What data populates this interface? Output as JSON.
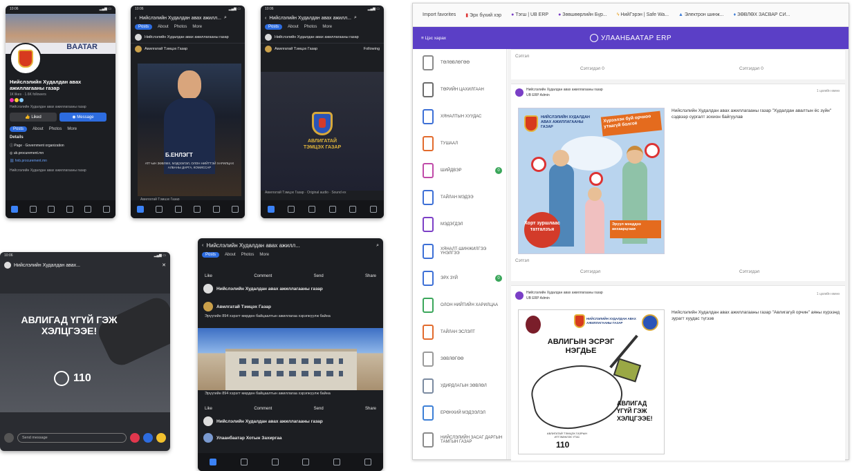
{
  "phone1": {
    "status_time": "10:06",
    "cover_text": "BAATAR",
    "page_name": "Нийслэлийн Худалдан авах ажиллагааны газар",
    "likes_line": "1К likes · 1.6K followers",
    "bio": "Нийслэлийн Худалдан авах ажиллагааны газар",
    "liked_label": "Liked",
    "message_label": "Message",
    "tabs": [
      "Posts",
      "About",
      "Photos",
      "More"
    ],
    "details_title": "Details",
    "detail_items": [
      "Page · Government organization",
      "ub.procurement.mn",
      "hnb.procurement.mn"
    ],
    "footer_text": "Нийслэлийн Худалдан авах ажиллагааны газар"
  },
  "phone2": {
    "status_time": "10:06",
    "header_title": "Нийслэлийн Худалдан авах ажилл...",
    "tabs": [
      "Posts",
      "About",
      "Photos",
      "More"
    ],
    "post_author": "Нийслэлийн Худалдан авах ажиллагааны газар",
    "shared_author": "Авилгатай Тэмцэх Газар",
    "person_name": "Б.ЕНЛЭГТ",
    "caption": "АТГ-ЫН ЗӨВЛӨХ, МЭДЭЭЛЭЛ, ОЛОН НИЙТТЭЙ ХАРИЛЦАХ АЛБАНЫ ДАРГА, КОМИССАР",
    "footer": "Авилгатай Тэмцэх Газар"
  },
  "phone3": {
    "status_time": "10:06",
    "header_title": "Нийслэлийн Худалдан авах ажилл...",
    "tabs": [
      "Posts",
      "About",
      "Photos",
      "More"
    ],
    "post_author": "Нийслэлийн Худалдан авах ажиллагааны газар",
    "shared_author": "Авилгатай Тэмцэх Газар",
    "following": "Following",
    "logo_text": "АВЛИГАТАЙ ТЭМЦЭХ ГАЗАР",
    "footer": "Авилгатай Тэмцэх Газар · Original audio · Sound ex"
  },
  "phone4": {
    "status_time": "10:06",
    "header_title": "Нийслэлийн Худалдан авах...",
    "headline": "АВЛИГАД ҮГҮЙ ГЭЖ ХЭЛЦГЭЭЕ!",
    "hotline": "110",
    "message_placeholder": "Send message"
  },
  "phone5": {
    "header_title": "Нийслэлийн Худалдан авах ажилл...",
    "tabs": [
      "Posts",
      "About",
      "Photos",
      "More"
    ],
    "like": "Like",
    "comment": "Comment",
    "send": "Send",
    "share": "Share",
    "post1_author": "Нийслэлийн Худалдан авах ажиллагааны газар",
    "post2_author": "Авилгатай Тэмцэх Газар",
    "post2_text": "Эрүүгийн 894 хэрэгт мөрдөн байцаалтын ажиллагаа хэрэгжүүлж байна",
    "image_caption": "Эрүүгийн 894 хэрэгт мөрдөн байцаалтын ажиллагаа хэрэгжүүлж байна",
    "post3_author": "Нийслэлийн Худалдан авах ажиллагааны газар",
    "post4_author": "Улаанбаатар Хотын Захиргаа"
  },
  "browser": {
    "bookmarks": [
      "Import favorites",
      "Эрх бүхий хэр",
      "Тэгш | UB ERP",
      "Зөвшөөрлийн Бүр...",
      "НийГэрэн | Safe Wa...",
      "Электрон шинж...",
      "ЗӨВЛӨХ ЗАСВАР СИ..."
    ],
    "menu_label": "Цэс харах",
    "app_title": "УЛААНБААТАР ERP",
    "sidebar_items": [
      {
        "label": "ТӨЛӨВЛӨГӨӨ",
        "color": "#8a8a8a",
        "badge": ""
      },
      {
        "label": "ТӨРИЙН ЦАХИЛГААН",
        "color": "#6b6b6b",
        "badge": ""
      },
      {
        "label": "ХЯНАЛТЫН ХУУДАС",
        "color": "#3c6fd6",
        "badge": ""
      },
      {
        "label": "ТУШААЛ",
        "color": "#e26a2c",
        "badge": ""
      },
      {
        "label": "ШИЙДВЭР",
        "color": "#c04aa8",
        "badge": "0"
      },
      {
        "label": "ТАЙЛАН МЭДЭЭ",
        "color": "#3c6fd6",
        "badge": ""
      },
      {
        "label": "МЭДЭГДЭЛ",
        "color": "#7c3fc6",
        "badge": ""
      },
      {
        "label": "ХЯНАЛТ-ШИНЖИЛГЭЭ ҮНЭЛГЭЭ",
        "color": "#3c6fd6",
        "badge": ""
      },
      {
        "label": "ЭРХ ЗҮЙ",
        "color": "#3c6fd6",
        "badge": "0"
      },
      {
        "label": "ОЛОН НИЙТИЙН ХАРИЛЦАА",
        "color": "#3aa65a",
        "badge": ""
      },
      {
        "label": "ТАЙЛАН ЭСЛЭЛТ",
        "color": "#e26a2c",
        "badge": ""
      },
      {
        "label": "ЗӨВЛӨГӨӨ",
        "color": "#9a9a9a",
        "badge": ""
      },
      {
        "label": "УДИРДЛАГЫН ЗӨВЛӨЛ",
        "color": "#7a8aa0",
        "badge": ""
      },
      {
        "label": "ЕРӨНХИЙ МЭДЭЭЛЭЛ",
        "color": "#3c7fd6",
        "badge": ""
      },
      {
        "label": "НИЙСЛЭЛИЙН ЗАСАГ ДАРГЫН ТАМГЫН ГАЗАР",
        "color": "#8a8a8a",
        "badge": ""
      }
    ],
    "top_like": "Сэтгэл",
    "top_comment_left": "Сэтгэгдэл 0",
    "top_comment_right": "Сэтгэгдэл 0",
    "post1": {
      "author": "Нийслэлийн Худалдан авах ажиллагааны газар",
      "role": "UB ERP Admin",
      "time": "1 цагийн өмнө",
      "text": "Нийслэлийн Худалдан авах ажиллагааны газар \"Худалдан авалтын ёс зүйн\" сэдвээр сургалт зохион байгуулав",
      "poster_org": "НИЙСЛЭЛИЙН ХУДАЛДАН АВАХ АЖИЛЛАГААНЫ ГАЗАР",
      "poster_tagline": "Хүрээлэн буй орчноо утаагүй болгоё",
      "poster_main": "Хорт зуршлаас татгалзъя",
      "poster_side": "Эрүүл мэнддээ анхаарцгаая",
      "like_label": "Сэтгэл",
      "comment_label": "Сэтгэгдэл"
    },
    "post2": {
      "author": "Нийслэлийн Худалдан авах ажиллагааны газар",
      "role": "UB ERP Admin",
      "time": "1 цагийн өмнө",
      "text": "Нийслэлийн Худалдан авах ажиллагааны газар \"Авлигагүй орчин\" аяны хүрээнд зурагт хуудас түгээв",
      "poster_org": "НИЙСЛЭЛИЙН ХУДАЛДАН АВАХ АЖИЛЛАГААНЫ ГАЗАР",
      "poster_title": "АВЛИГЫН ЭСРЭГ НЭГДЬЕ",
      "poster_slogan": "АВЛИГАД ҮГҮЙ ГЭЖ ХЭЛЦГЭЭЕ!",
      "poster_hotline_label": "АВЛИГАТАЙ ТЭМЦЭХ ГАЗРЫН ИТГЭМЖЛЭХ УТАС",
      "poster_hotline": "110"
    }
  },
  "colors": {
    "purple": "#5b3fc6",
    "fb_blue": "#2d6cdf",
    "green_badge": "#3aa65a"
  }
}
